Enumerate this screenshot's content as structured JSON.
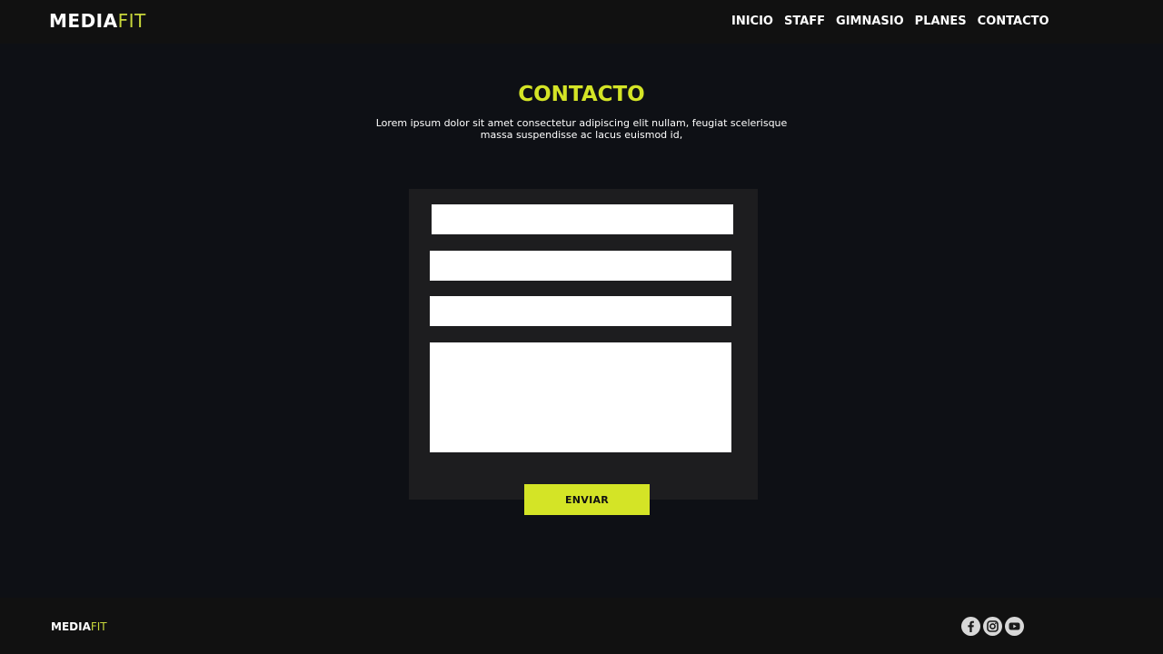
{
  "header": {
    "logo_main": "MEDIA",
    "logo_accent": "FIT",
    "nav": [
      "INICIO",
      "STAFF",
      "GIMNASIO",
      "PLANES",
      "CONTACTO"
    ]
  },
  "main": {
    "title": "CONTACTO",
    "description": "Lorem ipsum dolor sit amet consectetur adipiscing elit nullam, feugiat scelerisque massa suspendisse ac lacus euismod id,",
    "form": {
      "fields": [
        {
          "value": "",
          "placeholder": ""
        },
        {
          "value": "",
          "placeholder": ""
        },
        {
          "value": "",
          "placeholder": ""
        },
        {
          "value": "",
          "placeholder": ""
        }
      ],
      "submit_label": "ENVIAR"
    }
  },
  "footer": {
    "logo_main": "MEDIA",
    "logo_accent": "FIT",
    "social_icons": [
      "facebook-icon",
      "instagram-icon",
      "youtube-icon"
    ]
  },
  "colors": {
    "accent": "#d4e426",
    "background": "#0e1015",
    "bar": "#111111",
    "form_panel": "#1d1d1f"
  }
}
